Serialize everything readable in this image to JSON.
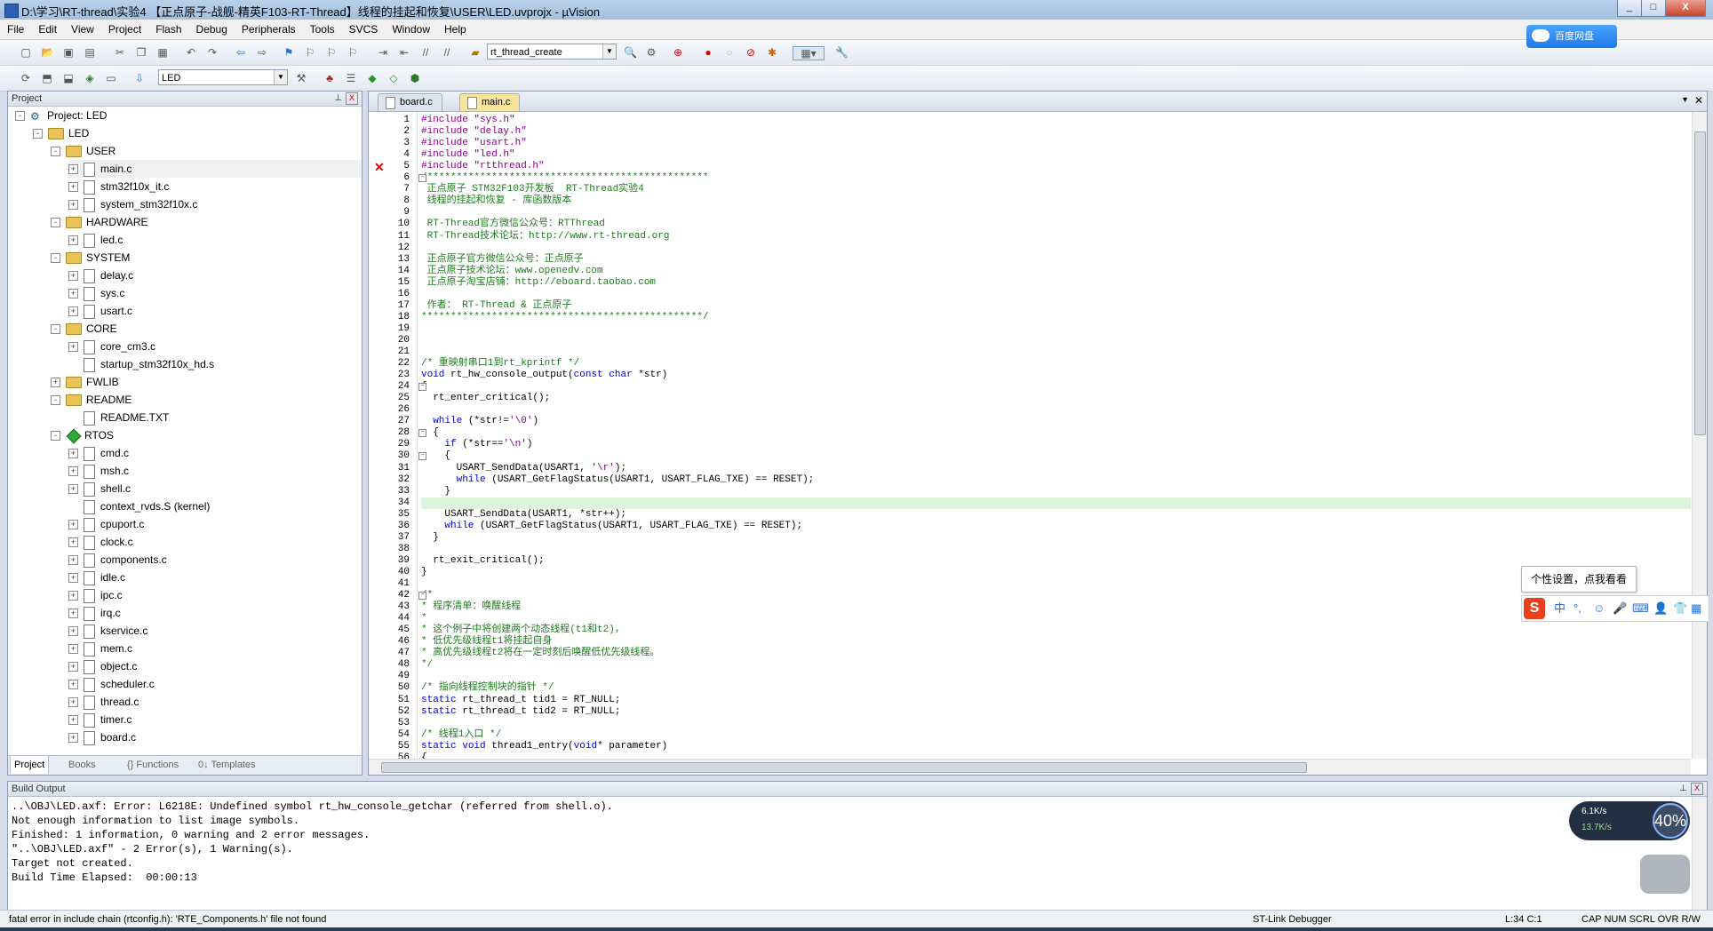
{
  "window": {
    "title": "D:\\学习\\RT-thread\\实验4 【正点原子-战舰-精英F103-RT-Thread】线程的挂起和恢复\\USER\\LED.uvprojx - µVision",
    "minimize": "_",
    "maximize": "□",
    "close": "X"
  },
  "menu": [
    "File",
    "Edit",
    "View",
    "Project",
    "Flash",
    "Debug",
    "Peripherals",
    "Tools",
    "SVCS",
    "Window",
    "Help"
  ],
  "toolbar1": {
    "find_combo": "rt_thread_create"
  },
  "toolbar2": {
    "target_combo": "LED"
  },
  "baidu_button": "百度网盘",
  "project_pane": {
    "title": "Project",
    "pin": "⊥",
    "close": "X",
    "tree": [
      {
        "level": 0,
        "type": "proj",
        "label": "Project: LED",
        "exp": "-"
      },
      {
        "level": 1,
        "type": "folder",
        "label": "LED",
        "exp": "-"
      },
      {
        "level": 2,
        "type": "folder",
        "label": "USER",
        "exp": "-"
      },
      {
        "level": 3,
        "type": "file",
        "label": "main.c",
        "exp": "+",
        "selected": true
      },
      {
        "level": 3,
        "type": "file",
        "label": "stm32f10x_it.c",
        "exp": "+"
      },
      {
        "level": 3,
        "type": "file",
        "label": "system_stm32f10x.c",
        "exp": "+"
      },
      {
        "level": 2,
        "type": "folder",
        "label": "HARDWARE",
        "exp": "-"
      },
      {
        "level": 3,
        "type": "file",
        "label": "led.c",
        "exp": "+"
      },
      {
        "level": 2,
        "type": "folder",
        "label": "SYSTEM",
        "exp": "-"
      },
      {
        "level": 3,
        "type": "file",
        "label": "delay.c",
        "exp": "+"
      },
      {
        "level": 3,
        "type": "file",
        "label": "sys.c",
        "exp": "+"
      },
      {
        "level": 3,
        "type": "file",
        "label": "usart.c",
        "exp": "+"
      },
      {
        "level": 2,
        "type": "folder",
        "label": "CORE",
        "exp": "-"
      },
      {
        "level": 3,
        "type": "file",
        "label": "core_cm3.c",
        "exp": "+"
      },
      {
        "level": 3,
        "type": "file",
        "label": "startup_stm32f10x_hd.s",
        "exp": ""
      },
      {
        "level": 2,
        "type": "folder",
        "label": "FWLIB",
        "exp": "+"
      },
      {
        "level": 2,
        "type": "folder",
        "label": "README",
        "exp": "-"
      },
      {
        "level": 3,
        "type": "file",
        "label": "README.TXT",
        "exp": ""
      },
      {
        "level": 2,
        "type": "diamond",
        "label": "RTOS",
        "exp": "-"
      },
      {
        "level": 3,
        "type": "file",
        "label": "cmd.c",
        "exp": "+"
      },
      {
        "level": 3,
        "type": "file",
        "label": "msh.c",
        "exp": "+"
      },
      {
        "level": 3,
        "type": "file",
        "label": "shell.c",
        "exp": "+"
      },
      {
        "level": 3,
        "type": "file",
        "label": "context_rvds.S (kernel)",
        "exp": ""
      },
      {
        "level": 3,
        "type": "file",
        "label": "cpuport.c",
        "exp": "+"
      },
      {
        "level": 3,
        "type": "file",
        "label": "clock.c",
        "exp": "+"
      },
      {
        "level": 3,
        "type": "file",
        "label": "components.c",
        "exp": "+"
      },
      {
        "level": 3,
        "type": "file",
        "label": "idle.c",
        "exp": "+"
      },
      {
        "level": 3,
        "type": "file",
        "label": "ipc.c",
        "exp": "+"
      },
      {
        "level": 3,
        "type": "file",
        "label": "irq.c",
        "exp": "+"
      },
      {
        "level": 3,
        "type": "file",
        "label": "kservice.c",
        "exp": "+"
      },
      {
        "level": 3,
        "type": "file",
        "label": "mem.c",
        "exp": "+"
      },
      {
        "level": 3,
        "type": "file",
        "label": "object.c",
        "exp": "+"
      },
      {
        "level": 3,
        "type": "file",
        "label": "scheduler.c",
        "exp": "+"
      },
      {
        "level": 3,
        "type": "file",
        "label": "thread.c",
        "exp": "+"
      },
      {
        "level": 3,
        "type": "file",
        "label": "timer.c",
        "exp": "+"
      },
      {
        "level": 3,
        "type": "file",
        "label": "board.c",
        "exp": "+"
      }
    ],
    "tabs": [
      "Project",
      "Books",
      "{} Functions",
      "0↓ Templates"
    ]
  },
  "editor": {
    "tabs": [
      {
        "label": "board.c",
        "active": false
      },
      {
        "label": "main.c",
        "active": true
      }
    ],
    "dropdown": "▼",
    "close": "✕",
    "error_marker": "✕",
    "error_line": 5,
    "current_line": 34,
    "lines": [
      [
        [
          "pp",
          "#include \"sys.h\""
        ]
      ],
      [
        [
          "pp",
          "#include \"delay.h\""
        ]
      ],
      [
        [
          "pp",
          "#include \"usart.h\""
        ]
      ],
      [
        [
          "pp",
          "#include \"led.h\""
        ]
      ],
      [
        [
          "pp",
          "#include \"rtthread.h\""
        ]
      ],
      [
        [
          "cmt",
          "/************************************************"
        ]
      ],
      [
        [
          "cmt",
          " 正点原子 STM32F103开发板  RT-Thread实验4"
        ]
      ],
      [
        [
          "cmt",
          " 线程的挂起和恢复 - 库函数版本"
        ]
      ],
      [
        [
          "cmt",
          ""
        ]
      ],
      [
        [
          "cmt",
          " RT-Thread官方微信公众号：RTThread"
        ]
      ],
      [
        [
          "cmt",
          " RT-Thread技术论坛：http://www.rt-thread.org"
        ]
      ],
      [
        [
          "cmt",
          ""
        ]
      ],
      [
        [
          "cmt",
          " 正点原子官方微信公众号：正点原子"
        ]
      ],
      [
        [
          "cmt",
          " 正点原子技术论坛：www.openedv.com"
        ]
      ],
      [
        [
          "cmt",
          " 正点原子淘宝店铺：http://eboard.taobao.com"
        ]
      ],
      [
        [
          "cmt",
          ""
        ]
      ],
      [
        [
          "cmt",
          " 作者： RT-Thread & 正点原子"
        ]
      ],
      [
        [
          "cmt",
          "************************************************/"
        ]
      ],
      [
        [
          "bl",
          ""
        ]
      ],
      [
        [
          "bl",
          ""
        ]
      ],
      [
        [
          "bl",
          ""
        ]
      ],
      [
        [
          "cmt",
          "/* 重映射串口1到rt_kprintf */"
        ]
      ],
      [
        [
          "kw",
          "void"
        ],
        [
          "bl",
          " rt_hw_console_output("
        ],
        [
          "kw",
          "const"
        ],
        [
          "bl",
          " "
        ],
        [
          "kw",
          "char"
        ],
        [
          "bl",
          " *str)"
        ]
      ],
      [
        [
          "bl",
          "{"
        ]
      ],
      [
        [
          "bl",
          "  rt_enter_critical();"
        ]
      ],
      [
        [
          "bl",
          ""
        ]
      ],
      [
        [
          "bl",
          "  "
        ],
        [
          "kw",
          "while"
        ],
        [
          "bl",
          " (*str!="
        ],
        [
          "str",
          "'\\0'"
        ],
        [
          "bl",
          ")"
        ]
      ],
      [
        [
          "bl",
          "  {"
        ]
      ],
      [
        [
          "bl",
          "    "
        ],
        [
          "kw",
          "if"
        ],
        [
          "bl",
          " (*str=="
        ],
        [
          "str",
          "'\\n'"
        ],
        [
          "bl",
          ")"
        ]
      ],
      [
        [
          "bl",
          "    {"
        ]
      ],
      [
        [
          "bl",
          "      USART_SendData(USART1, "
        ],
        [
          "str",
          "'\\r'"
        ],
        [
          "bl",
          ");"
        ]
      ],
      [
        [
          "bl",
          "      "
        ],
        [
          "kw",
          "while"
        ],
        [
          "bl",
          " (USART_GetFlagStatus(USART1, USART_FLAG_TXE) == RESET);"
        ]
      ],
      [
        [
          "bl",
          "    }"
        ]
      ],
      [
        [
          "bl",
          ""
        ]
      ],
      [
        [
          "bl",
          "    USART_SendData(USART1, *str++);"
        ]
      ],
      [
        [
          "bl",
          "    "
        ],
        [
          "kw",
          "while"
        ],
        [
          "bl",
          " (USART_GetFlagStatus(USART1, USART_FLAG_TXE) == RESET);"
        ]
      ],
      [
        [
          "bl",
          "  }"
        ]
      ],
      [
        [
          "bl",
          ""
        ]
      ],
      [
        [
          "bl",
          "  rt_exit_critical();"
        ]
      ],
      [
        [
          "bl",
          "}"
        ]
      ],
      [
        [
          "bl",
          ""
        ]
      ],
      [
        [
          "cmt",
          "/*"
        ]
      ],
      [
        [
          "cmt",
          "* 程序清单：唤醒线程"
        ]
      ],
      [
        [
          "cmt",
          "*"
        ]
      ],
      [
        [
          "cmt",
          "* 这个例子中将创建两个动态线程(t1和t2)，"
        ]
      ],
      [
        [
          "cmt",
          "* 低优先级线程t1将挂起自身"
        ]
      ],
      [
        [
          "cmt",
          "* 高优先级线程t2将在一定时刻后唤醒低优先级线程。"
        ]
      ],
      [
        [
          "cmt",
          "*/"
        ]
      ],
      [
        [
          "bl",
          ""
        ]
      ],
      [
        [
          "cmt",
          "/* 指向线程控制块的指针 */"
        ]
      ],
      [
        [
          "kw",
          "static"
        ],
        [
          "bl",
          " rt_thread_t tid1 = RT_NULL;"
        ]
      ],
      [
        [
          "kw",
          "static"
        ],
        [
          "bl",
          " rt_thread_t tid2 = RT_NULL;"
        ]
      ],
      [
        [
          "bl",
          ""
        ]
      ],
      [
        [
          "cmt",
          "/* 线程1入口 */"
        ]
      ],
      [
        [
          "kw",
          "static"
        ],
        [
          "bl",
          " "
        ],
        [
          "kw",
          "void"
        ],
        [
          "bl",
          " thread1_entry("
        ],
        [
          "kw",
          "void"
        ],
        [
          "bl",
          "* parameter)"
        ]
      ],
      [
        [
          "bl",
          "{"
        ]
      ]
    ],
    "fold_lines": [
      6,
      24,
      28,
      30,
      42
    ]
  },
  "build_output": {
    "title": "Build Output",
    "pin": "⊥",
    "close": "X",
    "lines": [
      "..\\OBJ\\LED.axf: Error: L6218E: Undefined symbol rt_hw_console_getchar (referred from shell.o).",
      "Not enough information to list image symbols.",
      "Finished: 1 information, 0 warning and 2 error messages.",
      "\"..\\OBJ\\LED.axf\" - 2 Error(s), 1 Warning(s).",
      "Target not created.",
      "Build Time Elapsed:  00:00:13"
    ]
  },
  "ime": {
    "tip": "个性设置，点我看看",
    "logo": "S",
    "mode": "中"
  },
  "netmon": {
    "up": "6.1K/s",
    "down": "13.7K/s",
    "pct": "40%"
  },
  "status": {
    "message": "fatal error in include chain (rtconfig.h): 'RTE_Components.h' file not found",
    "debugger": "ST-Link Debugger",
    "position": "L:34 C:1",
    "flags": "CAP  NUM  SCRL  OVR  R/W"
  }
}
